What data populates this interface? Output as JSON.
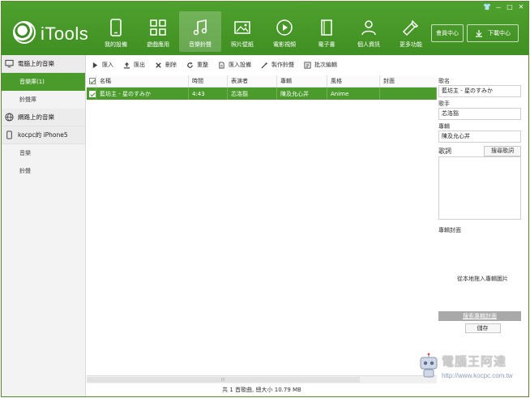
{
  "app": {
    "title": "iTools"
  },
  "window_controls": {
    "shirt": "👕",
    "min": "－",
    "max": "□",
    "close": "✕"
  },
  "nav": [
    {
      "label": "我的設備",
      "icon": "phone-icon"
    },
    {
      "label": "遊戲應用",
      "icon": "apps-icon"
    },
    {
      "label": "音樂鈴聲",
      "icon": "music-icon",
      "active": true
    },
    {
      "label": "照片壁紙",
      "icon": "photo-icon"
    },
    {
      "label": "電影視頻",
      "icon": "video-icon"
    },
    {
      "label": "電子書",
      "icon": "book-icon"
    },
    {
      "label": "個人資訊",
      "icon": "person-icon"
    },
    {
      "label": "更多功能",
      "icon": "wrench-icon"
    }
  ],
  "header_buttons": {
    "member": "會員中心",
    "download": "下載中心"
  },
  "sidebar": {
    "sections": [
      {
        "title": "電腦上的音樂",
        "icon": "monitor-icon",
        "items": [
          "音樂庫(1)",
          "鈴聲庫"
        ]
      },
      {
        "title": "網路上的音樂",
        "icon": "globe-icon",
        "items": []
      },
      {
        "title": "kocpc的 iPhone5",
        "icon": "phone-icon",
        "items": [
          "音樂",
          "鈴聲"
        ]
      }
    ]
  },
  "toolbar": {
    "import": "匯入",
    "export": "匯出",
    "delete": "刪除",
    "refresh": "重整",
    "import_settings": "匯入設備",
    "make_ringtone": "製作鈴聲",
    "batch_edit": "批次編輯"
  },
  "table": {
    "headers": {
      "name": "名稱",
      "time": "時間",
      "artist": "表演者",
      "album": "專輯",
      "genre": "風格",
      "cover": "封面"
    },
    "rows": [
      {
        "name": "藍坊主 - 星のすみか",
        "time": "4:43",
        "artist": "芯洛豁",
        "album": "陳及允心并",
        "genre": "Anime",
        "cover": ""
      }
    ]
  },
  "status": "共 1 首歌曲, 總大小 10.79 MB",
  "details": {
    "song_label": "歌名",
    "song_value": "藍坊主 - 星のすみか",
    "artist_label": "歌手",
    "artist_value": "芯洛豁",
    "album_label": "專輯",
    "album_value": "陳及允心并",
    "lyrics_label": "歌詞",
    "lyrics_button": "搜尋歌詞",
    "cover_label": "專輯封面",
    "cover_hint": "從本地拖入專輯圖片",
    "find_cover_button": "搜索專輯封面",
    "save_button": "儲存"
  },
  "watermark": {
    "title": "電腦王阿達",
    "url": "http://www.kocpc.com.tw"
  },
  "colors": {
    "brand_green": "#4b9b2c",
    "header_green": "#46992a"
  }
}
